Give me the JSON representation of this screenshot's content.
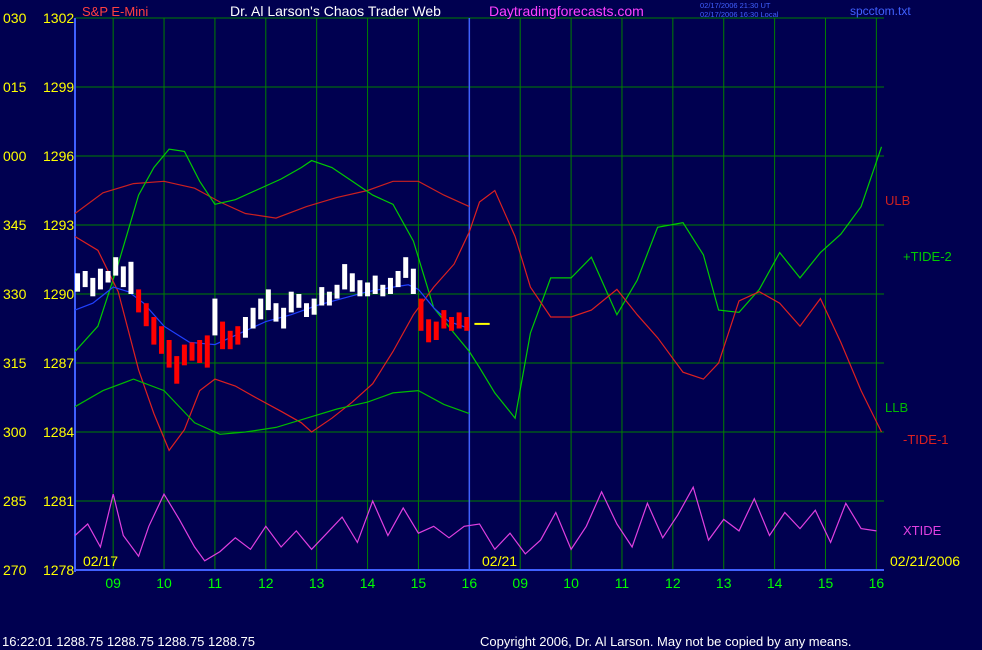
{
  "header": {
    "instrument": "S&P E-Mini",
    "title": "Dr. Al Larson's Chaos Trader Web",
    "site": "Daytradingforecasts.com",
    "stamp_ut": "02/17/2006 21:30 UT",
    "stamp_local": "02/17/2006 16:30 Local",
    "file": "spcctom.txt"
  },
  "footer": {
    "quote": "16:22:01  1288.75 1288.75 1288.75 1288.75",
    "copyright": "Copyright 2006, Dr. Al Larson. May not be copied by any means."
  },
  "colors": {
    "background": "#000050",
    "grid": "#008000",
    "price_axis": "#ffff00",
    "time_axis": "#00ff00",
    "ulb": "#cc2020",
    "tide_plus": "#00cc00",
    "tide_minus": "#dd2020",
    "llb": "#00bb00",
    "xtide": "#e040e0",
    "ma": "#2040ff",
    "bar_up": "#ffffff",
    "bar_down": "#ff0000",
    "title": "#ffffff",
    "site": "#ff40ff",
    "instrument": "#ff4040",
    "stamp": "#4060ff"
  },
  "chart_data": {
    "type": "line",
    "y_axis": {
      "price_labels": [
        "1302",
        "1299",
        "1296",
        "1293",
        "1290",
        "1287",
        "1284",
        "1281",
        "1278"
      ],
      "angle_labels": [
        "030",
        "015",
        "000",
        "345",
        "330",
        "315",
        "300",
        "285",
        "270"
      ],
      "ylim": [
        1278,
        1302
      ]
    },
    "x_axis": {
      "ticks": [
        "09",
        "10",
        "11",
        "12",
        "13",
        "14",
        "15",
        "16",
        "09",
        "10",
        "11",
        "12",
        "13",
        "14",
        "15",
        "16"
      ],
      "date_start": "02/17",
      "date_mid": "02/21",
      "date_end": "02/21/2006",
      "xlim": [
        8.25,
        24.15
      ]
    },
    "grid": true,
    "series": [
      {
        "name": "ULB",
        "color_key": "ulb",
        "x": [
          8.25,
          8.8,
          9.4,
          10,
          10.6,
          11.1,
          11.6,
          12.2,
          12.8,
          13.4,
          14,
          14.5,
          15,
          15.5,
          16
        ],
        "y": [
          1293.5,
          1294.4,
          1294.8,
          1294.9,
          1294.6,
          1294.0,
          1293.5,
          1293.3,
          1293.8,
          1294.2,
          1294.5,
          1294.9,
          1294.9,
          1294.3,
          1293.8
        ]
      },
      {
        "name": "+TIDE-2",
        "color_key": "tide_plus",
        "x": [
          8.25,
          8.7,
          9.1,
          9.5,
          9.8,
          10.1,
          10.4,
          10.7,
          11.0,
          11.4,
          11.8,
          12.3,
          12.7,
          12.9,
          13.3,
          13.7,
          14.1,
          14.5,
          14.9,
          15.3,
          15.7,
          16.0,
          16.2,
          16.5,
          16.9,
          17.2,
          17.6,
          18.0,
          18.4,
          18.9,
          19.3,
          19.7,
          20.2,
          20.6,
          20.9,
          21.3,
          21.7,
          22.1,
          22.5,
          22.9,
          23.3,
          23.7,
          24.1
        ],
        "y": [
          1287.5,
          1288.6,
          1291.3,
          1294.3,
          1295.5,
          1296.3,
          1296.2,
          1294.9,
          1293.9,
          1294.1,
          1294.5,
          1295.0,
          1295.5,
          1295.8,
          1295.5,
          1294.9,
          1294.3,
          1293.9,
          1292.3,
          1289.4,
          1288.3,
          1287.5,
          1286.8,
          1285.7,
          1284.6,
          1288.3,
          1290.7,
          1290.7,
          1291.6,
          1289.1,
          1290.6,
          1292.9,
          1293.1,
          1291.7,
          1289.3,
          1289.2,
          1290.2,
          1291.8,
          1290.7,
          1291.8,
          1292.6,
          1293.8,
          1296.4
        ]
      },
      {
        "name": "-TIDE-1",
        "color_key": "tide_minus",
        "x": [
          8.25,
          8.7,
          9.1,
          9.5,
          9.8,
          10.1,
          10.4,
          10.7,
          11.0,
          11.4,
          11.8,
          12.3,
          12.7,
          12.9,
          13.3,
          13.7,
          14.1,
          14.5,
          14.9,
          15.3,
          15.7,
          16.0,
          16.2,
          16.5,
          16.9,
          17.2,
          17.6,
          18.0,
          18.4,
          18.9,
          19.3,
          19.7,
          20.2,
          20.6,
          20.9,
          21.3,
          21.7,
          22.1,
          22.5,
          22.9,
          23.3,
          23.7,
          24.1
        ],
        "y": [
          1292.5,
          1291.9,
          1290.1,
          1286.7,
          1284.8,
          1283.2,
          1284.1,
          1285.8,
          1286.3,
          1286.0,
          1285.5,
          1284.9,
          1284.4,
          1284.0,
          1284.6,
          1285.3,
          1286.1,
          1287.5,
          1289.1,
          1290.3,
          1291.3,
          1292.7,
          1294.0,
          1294.5,
          1292.5,
          1290.3,
          1289.0,
          1289.0,
          1289.3,
          1290.2,
          1289.1,
          1288.1,
          1286.6,
          1286.3,
          1287.0,
          1289.7,
          1290.1,
          1289.6,
          1288.6,
          1289.8,
          1287.9,
          1285.8,
          1284.0
        ]
      },
      {
        "name": "LLB",
        "color_key": "llb",
        "x": [
          8.25,
          8.8,
          9.4,
          10,
          10.6,
          11.1,
          11.6,
          12.2,
          12.8,
          13.4,
          14,
          14.5,
          15,
          15.5,
          16
        ],
        "y": [
          1285.1,
          1285.8,
          1286.3,
          1285.8,
          1284.4,
          1283.9,
          1284.0,
          1284.2,
          1284.6,
          1285.0,
          1285.3,
          1285.7,
          1285.8,
          1285.2,
          1284.8
        ]
      },
      {
        "name": "XTIDE",
        "color_key": "xtide",
        "x": [
          8.25,
          8.5,
          8.75,
          9.0,
          9.2,
          9.5,
          9.7,
          10.0,
          10.3,
          10.6,
          10.8,
          11.1,
          11.4,
          11.7,
          12.0,
          12.3,
          12.6,
          12.9,
          13.2,
          13.5,
          13.8,
          14.1,
          14.4,
          14.7,
          15.0,
          15.3,
          15.6,
          15.9,
          16.2,
          16.5,
          16.8,
          17.1,
          17.4,
          17.7,
          18.0,
          18.3,
          18.6,
          18.9,
          19.2,
          19.5,
          19.8,
          20.1,
          20.4,
          20.7,
          21.0,
          21.3,
          21.6,
          21.9,
          22.2,
          22.5,
          22.8,
          23.1,
          23.4,
          23.7,
          24.0
        ],
        "y": [
          1279.5,
          1280.0,
          1279.0,
          1281.3,
          1279.5,
          1278.6,
          1279.9,
          1281.3,
          1280.2,
          1279.0,
          1278.4,
          1278.8,
          1279.4,
          1278.9,
          1279.9,
          1279.0,
          1279.7,
          1278.9,
          1279.6,
          1280.3,
          1279.2,
          1281.0,
          1279.5,
          1280.7,
          1279.6,
          1279.9,
          1279.4,
          1279.9,
          1280.0,
          1278.9,
          1279.6,
          1278.7,
          1279.3,
          1280.5,
          1278.9,
          1279.9,
          1281.4,
          1280.0,
          1279.0,
          1280.9,
          1279.4,
          1280.4,
          1281.6,
          1279.3,
          1280.2,
          1279.7,
          1281.1,
          1279.5,
          1280.5,
          1279.8,
          1280.6,
          1279.2,
          1280.9,
          1279.8,
          1279.7
        ]
      },
      {
        "name": "MA",
        "color_key": "ma",
        "x": [
          8.25,
          8.6,
          9.0,
          9.3,
          9.6,
          10.0,
          10.5,
          11.0,
          11.5,
          12.0,
          12.5,
          13.0,
          13.5,
          14.0,
          14.5,
          14.8,
          15.0,
          15.3,
          15.6,
          16.0
        ],
        "y": [
          1289.3,
          1289.6,
          1290.3,
          1290.1,
          1289.6,
          1288.6,
          1287.9,
          1287.8,
          1288.3,
          1288.8,
          1289.1,
          1289.5,
          1289.8,
          1290.1,
          1290.3,
          1290.4,
          1290.2,
          1289.4,
          1288.8,
          1288.5
        ]
      }
    ],
    "bars": [
      {
        "x": 8.3,
        "high": 1290.9,
        "low": 1290.1,
        "dir": "up"
      },
      {
        "x": 8.45,
        "high": 1291.0,
        "low": 1290.3,
        "dir": "up"
      },
      {
        "x": 8.6,
        "high": 1290.7,
        "low": 1289.9,
        "dir": "up"
      },
      {
        "x": 8.75,
        "high": 1291.1,
        "low": 1290.2,
        "dir": "up"
      },
      {
        "x": 8.9,
        "high": 1291.0,
        "low": 1290.5,
        "dir": "up"
      },
      {
        "x": 9.05,
        "high": 1291.6,
        "low": 1290.8,
        "dir": "up"
      },
      {
        "x": 9.2,
        "high": 1291.2,
        "low": 1290.3,
        "dir": "up"
      },
      {
        "x": 9.35,
        "high": 1291.4,
        "low": 1290.0,
        "dir": "up"
      },
      {
        "x": 9.5,
        "high": 1290.2,
        "low": 1289.2,
        "dir": "down"
      },
      {
        "x": 9.65,
        "high": 1289.6,
        "low": 1288.6,
        "dir": "down"
      },
      {
        "x": 9.8,
        "high": 1289.0,
        "low": 1287.8,
        "dir": "down"
      },
      {
        "x": 9.95,
        "high": 1288.6,
        "low": 1287.4,
        "dir": "down"
      },
      {
        "x": 10.1,
        "high": 1288.0,
        "low": 1286.8,
        "dir": "down"
      },
      {
        "x": 10.25,
        "high": 1287.3,
        "low": 1286.1,
        "dir": "down"
      },
      {
        "x": 10.4,
        "high": 1287.8,
        "low": 1286.9,
        "dir": "down"
      },
      {
        "x": 10.55,
        "high": 1287.9,
        "low": 1287.1,
        "dir": "down"
      },
      {
        "x": 10.7,
        "high": 1288.0,
        "low": 1287.0,
        "dir": "down"
      },
      {
        "x": 10.85,
        "high": 1288.2,
        "low": 1286.8,
        "dir": "down"
      },
      {
        "x": 11.0,
        "high": 1289.8,
        "low": 1288.2,
        "dir": "up"
      },
      {
        "x": 11.15,
        "high": 1288.8,
        "low": 1287.6,
        "dir": "down"
      },
      {
        "x": 11.3,
        "high": 1288.4,
        "low": 1287.6,
        "dir": "down"
      },
      {
        "x": 11.45,
        "high": 1288.6,
        "low": 1287.8,
        "dir": "down"
      },
      {
        "x": 11.6,
        "high": 1289.0,
        "low": 1288.1,
        "dir": "up"
      },
      {
        "x": 11.75,
        "high": 1289.4,
        "low": 1288.5,
        "dir": "up"
      },
      {
        "x": 11.9,
        "high": 1289.8,
        "low": 1288.9,
        "dir": "up"
      },
      {
        "x": 12.05,
        "high": 1290.2,
        "low": 1289.3,
        "dir": "up"
      },
      {
        "x": 12.2,
        "high": 1289.6,
        "low": 1288.8,
        "dir": "up"
      },
      {
        "x": 12.35,
        "high": 1289.4,
        "low": 1288.5,
        "dir": "up"
      },
      {
        "x": 12.5,
        "high": 1290.1,
        "low": 1289.2,
        "dir": "up"
      },
      {
        "x": 12.65,
        "high": 1290.0,
        "low": 1289.4,
        "dir": "up"
      },
      {
        "x": 12.8,
        "high": 1289.6,
        "low": 1289.0,
        "dir": "up"
      },
      {
        "x": 12.95,
        "high": 1289.8,
        "low": 1289.1,
        "dir": "up"
      },
      {
        "x": 13.1,
        "high": 1290.3,
        "low": 1289.5,
        "dir": "up"
      },
      {
        "x": 13.25,
        "high": 1290.1,
        "low": 1289.5,
        "dir": "up"
      },
      {
        "x": 13.4,
        "high": 1290.4,
        "low": 1289.8,
        "dir": "up"
      },
      {
        "x": 13.55,
        "high": 1291.3,
        "low": 1290.2,
        "dir": "up"
      },
      {
        "x": 13.7,
        "high": 1290.9,
        "low": 1290.1,
        "dir": "up"
      },
      {
        "x": 13.85,
        "high": 1290.6,
        "low": 1289.9,
        "dir": "up"
      },
      {
        "x": 14.0,
        "high": 1290.5,
        "low": 1289.9,
        "dir": "up"
      },
      {
        "x": 14.15,
        "high": 1290.8,
        "low": 1290.0,
        "dir": "up"
      },
      {
        "x": 14.3,
        "high": 1290.4,
        "low": 1289.9,
        "dir": "up"
      },
      {
        "x": 14.45,
        "high": 1290.7,
        "low": 1290.0,
        "dir": "up"
      },
      {
        "x": 14.6,
        "high": 1291.0,
        "low": 1290.3,
        "dir": "up"
      },
      {
        "x": 14.75,
        "high": 1291.6,
        "low": 1290.7,
        "dir": "up"
      },
      {
        "x": 14.9,
        "high": 1291.1,
        "low": 1290.0,
        "dir": "up"
      },
      {
        "x": 15.05,
        "high": 1289.8,
        "low": 1288.4,
        "dir": "down"
      },
      {
        "x": 15.2,
        "high": 1288.9,
        "low": 1287.9,
        "dir": "down"
      },
      {
        "x": 15.35,
        "high": 1288.8,
        "low": 1288.0,
        "dir": "down"
      },
      {
        "x": 15.5,
        "high": 1289.3,
        "low": 1288.5,
        "dir": "down"
      },
      {
        "x": 15.65,
        "high": 1289.0,
        "low": 1288.4,
        "dir": "down"
      },
      {
        "x": 15.8,
        "high": 1289.2,
        "low": 1288.5,
        "dir": "down"
      },
      {
        "x": 15.95,
        "high": 1289.0,
        "low": 1288.4,
        "dir": "down"
      }
    ],
    "labels": [
      {
        "text": "ULB",
        "color_key": "ulb"
      },
      {
        "text": "+TIDE-2",
        "color_key": "tide_plus"
      },
      {
        "text": "LLB",
        "color_key": "llb"
      },
      {
        "text": "-TIDE-1",
        "color_key": "tide_minus"
      },
      {
        "text": "XTIDE",
        "color_key": "xtide"
      }
    ]
  }
}
